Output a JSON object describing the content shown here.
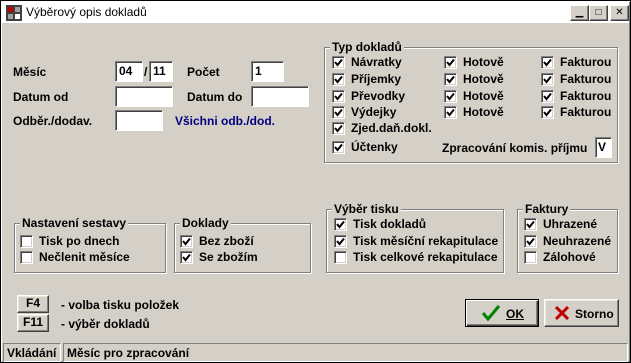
{
  "window": {
    "title": "Výběrový opis dokladů"
  },
  "form": {
    "month_label": "Měsíc",
    "month_value": "04",
    "month_sep": "/",
    "year_value": "11",
    "count_label": "Počet",
    "count_value": "1",
    "date_from_label": "Datum od",
    "date_from_value": "",
    "date_to_label": "Datum do",
    "date_to_value": "",
    "customer_label": "Odběr./dodav.",
    "customer_value": "",
    "customer_hint": "Všichni odb./dod.",
    "hint_color": "#000080"
  },
  "doc_types": {
    "title": "Typ dokladů",
    "rows": [
      {
        "label": "Návratky",
        "checked": true,
        "cash_label": "Hotově",
        "cash_checked": true,
        "invoice_label": "Fakturou",
        "invoice_checked": true
      },
      {
        "label": "Příjemky",
        "checked": true,
        "cash_label": "Hotově",
        "cash_checked": true,
        "invoice_label": "Fakturou",
        "invoice_checked": true
      },
      {
        "label": "Převodky",
        "checked": true,
        "cash_label": "Hotově",
        "cash_checked": true,
        "invoice_label": "Fakturou",
        "invoice_checked": true
      },
      {
        "label": "Výdejky",
        "checked": true,
        "cash_label": "Hotově",
        "cash_checked": true,
        "invoice_label": "Fakturou",
        "invoice_checked": true
      }
    ],
    "tax_docs_label": "Zjed.daň.dokl.",
    "tax_docs_checked": true,
    "receipts_label": "Účtenky",
    "receipts_checked": true,
    "commission_label": "Zpracování komis. příjmu",
    "commission_value": "V"
  },
  "report_settings": {
    "title": "Nastavení sestavy",
    "by_days_label": "Tisk po dnech",
    "by_days_checked": false,
    "no_split_label": "Nečlenit měsíce",
    "no_split_checked": false
  },
  "documents": {
    "title": "Doklady",
    "without_goods_label": "Bez zboží",
    "without_goods_checked": true,
    "with_goods_label": "Se zbožím",
    "with_goods_checked": true
  },
  "print_selection": {
    "title": "Výběr tisku",
    "print_docs_label": "Tisk dokladů",
    "print_docs_checked": true,
    "monthly_recap_label": "Tisk měsíční rekapitulace",
    "monthly_recap_checked": true,
    "total_recap_label": "Tisk celkové rekapitulace",
    "total_recap_checked": false
  },
  "invoices": {
    "title": "Faktury",
    "paid_label": "Uhrazené",
    "paid_checked": true,
    "unpaid_label": "Neuhrazené",
    "unpaid_checked": true,
    "advance_label": "Zálohové",
    "advance_checked": false
  },
  "hotkeys": {
    "f4_key": "F4",
    "f4_text": "- volba tisku položek",
    "f11_key": "F11",
    "f11_text": "- výběr dokladů"
  },
  "buttons": {
    "ok_label": "OK",
    "cancel_label": "Storno",
    "ok_icon": "checkmark-icon",
    "cancel_icon": "x-icon",
    "ok_icon_color": "#008000",
    "cancel_icon_color": "#c00000"
  },
  "status": {
    "mode": "Vkládání",
    "message": "Měsíc pro zpracování"
  }
}
